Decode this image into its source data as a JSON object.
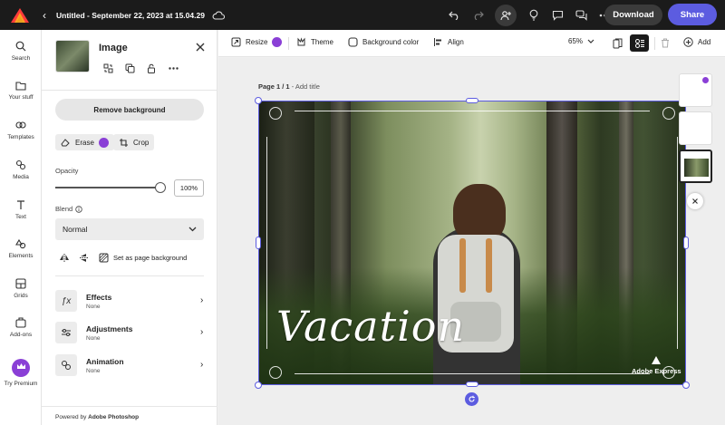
{
  "topbar": {
    "title": "Untitled - September 22, 2023 at 15.04.29",
    "download_label": "Download",
    "share_label": "Share"
  },
  "rail": {
    "items": [
      {
        "label": "Search",
        "icon": "search-icon"
      },
      {
        "label": "Your stuff",
        "icon": "folder-icon"
      },
      {
        "label": "Templates",
        "icon": "templates-icon"
      },
      {
        "label": "Media",
        "icon": "media-icon"
      },
      {
        "label": "Text",
        "icon": "text-icon"
      },
      {
        "label": "Elements",
        "icon": "elements-icon"
      },
      {
        "label": "Grids",
        "icon": "grids-icon"
      },
      {
        "label": "Add-ons",
        "icon": "addons-icon"
      },
      {
        "label": "Try Premium",
        "icon": "crown-icon"
      }
    ]
  },
  "panel": {
    "title": "Image",
    "remove_bg_label": "Remove background",
    "erase_label": "Erase",
    "crop_label": "Crop",
    "opacity_label": "Opacity",
    "opacity_value": "100%",
    "opacity_level": 1.0,
    "blend_label": "Blend",
    "blend_value": "Normal",
    "set_bg_label": "Set as page background",
    "features": [
      {
        "name": "Effects",
        "sub": "None",
        "icon": "fx-icon"
      },
      {
        "name": "Adjustments",
        "sub": "None",
        "icon": "sliders-icon"
      },
      {
        "name": "Animation",
        "sub": "None",
        "icon": "animation-icon"
      }
    ],
    "powered_prefix": "Powered by ",
    "powered_brand": "Adobe Photoshop"
  },
  "toolbar": {
    "resize_label": "Resize",
    "theme_label": "Theme",
    "bg_color_label": "Background color",
    "align_label": "Align",
    "zoom_value": "65%",
    "add_label": "Add"
  },
  "canvas": {
    "page_label": "Page 1 / 1",
    "add_title": "- Add title",
    "script_title": "Vacation",
    "watermark": "Adobe Express"
  },
  "colors": {
    "accent": "#5c5ce0",
    "premium": "#8a3fd6",
    "topbar": "#1b1b1b"
  }
}
